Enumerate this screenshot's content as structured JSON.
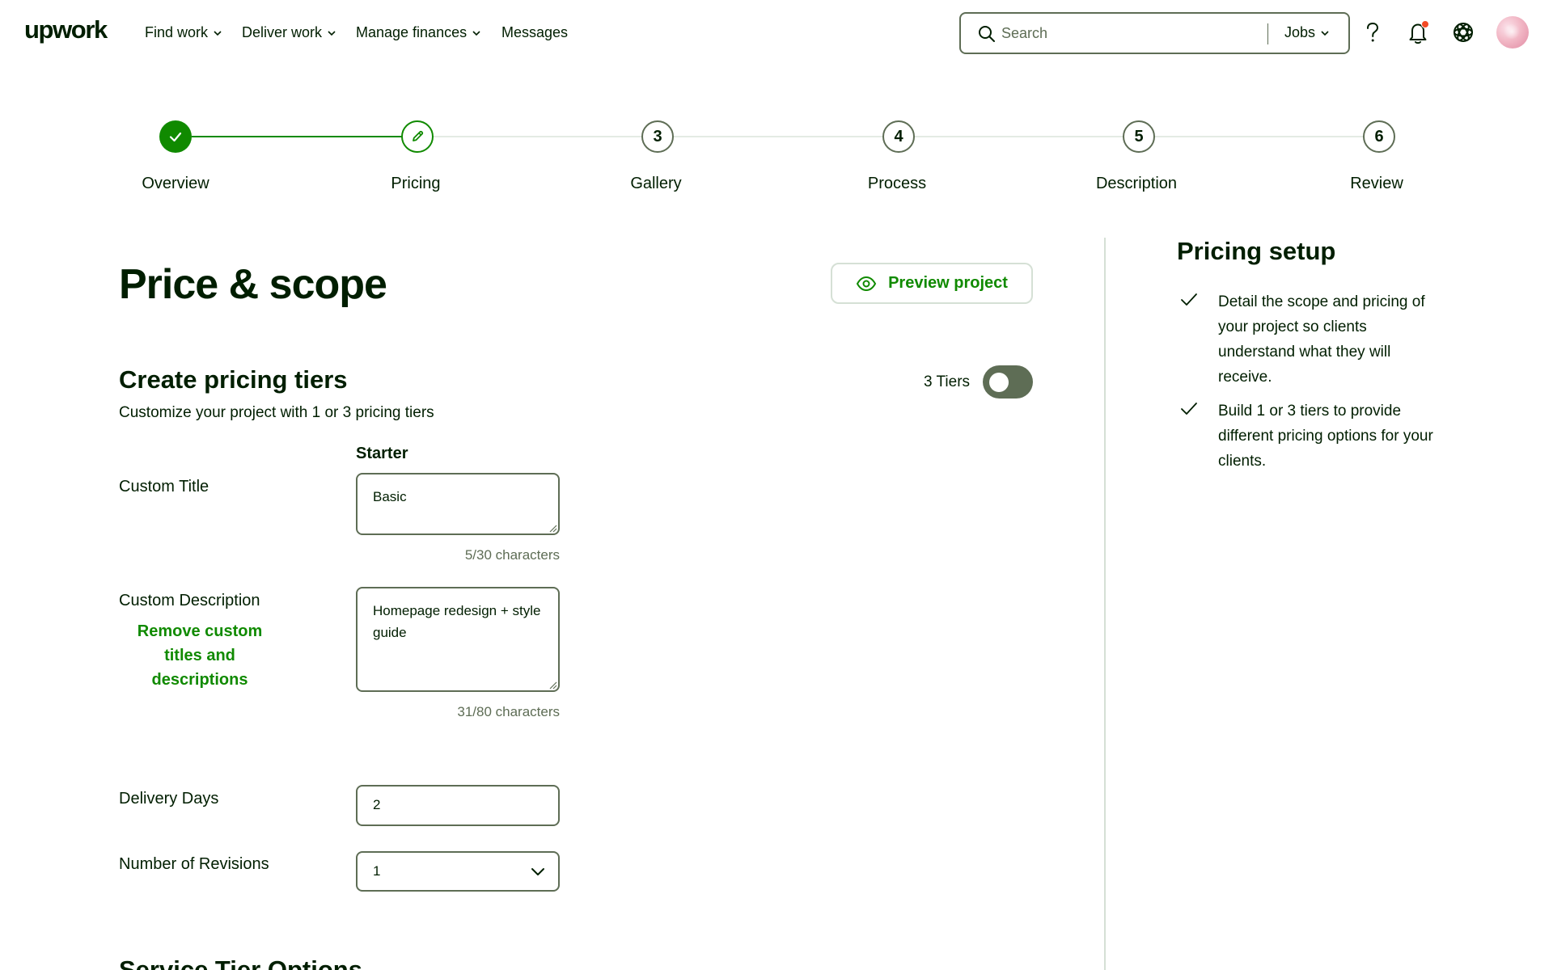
{
  "brand": {
    "logo_text": "upwork"
  },
  "nav": {
    "items": [
      {
        "label": "Find work",
        "dropdown": true
      },
      {
        "label": "Deliver work",
        "dropdown": true
      },
      {
        "label": "Manage finances",
        "dropdown": true
      },
      {
        "label": "Messages",
        "dropdown": false
      }
    ],
    "search": {
      "placeholder": "Search",
      "scope": "Jobs"
    },
    "icons": [
      "help-icon",
      "notification-bell-icon",
      "apps-icon"
    ]
  },
  "stepper": {
    "steps": [
      {
        "label": "Overview",
        "number": "1",
        "state": "complete"
      },
      {
        "label": "Pricing",
        "number": "2",
        "state": "current"
      },
      {
        "label": "Gallery",
        "number": "3",
        "state": "upcoming"
      },
      {
        "label": "Process",
        "number": "4",
        "state": "upcoming"
      },
      {
        "label": "Description",
        "number": "5",
        "state": "upcoming"
      },
      {
        "label": "Review",
        "number": "6",
        "state": "upcoming"
      }
    ]
  },
  "main": {
    "title": "Price & scope",
    "preview_button": "Preview project",
    "pricing_tiers": {
      "title": "Create pricing tiers",
      "subtitle": "Customize your project with 1 or 3 pricing tiers",
      "tiers_toggle_label": "3 Tiers",
      "tiers_toggle_on": false,
      "column_header": "Starter",
      "custom_title": {
        "label": "Custom Title",
        "value": "Basic",
        "count": "5/30 characters"
      },
      "custom_description": {
        "label": "Custom Description",
        "value": "Homepage redesign + style guide",
        "count": "31/80 characters"
      },
      "remove_link": "Remove custom titles and descriptions",
      "delivery_days": {
        "label": "Delivery Days",
        "value": "2"
      },
      "revisions": {
        "label": "Number of Revisions",
        "value": "1"
      }
    },
    "next_section_title": "Service Tier Options"
  },
  "sidebar": {
    "title": "Pricing setup",
    "tips": [
      "Detail the scope and pricing of your project so clients understand what they will receive.",
      "Build 1 or 3 tiers to provide different pricing options for your clients."
    ]
  },
  "colors": {
    "brand_green": "#108a00",
    "text": "#001e00",
    "muted": "#5e6d55",
    "border_light": "#d5e0d5",
    "notification": "#f24a25"
  }
}
